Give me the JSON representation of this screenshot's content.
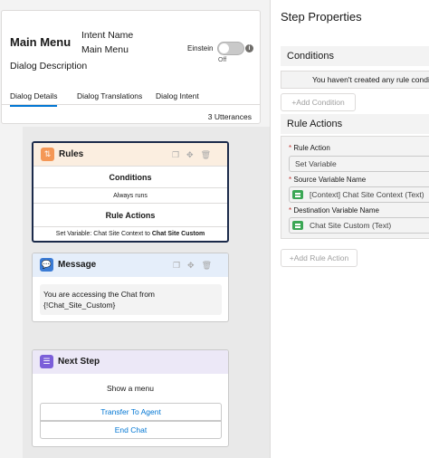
{
  "header": {
    "title": "Main Menu",
    "intent_label": "Intent Name",
    "intent_value": "Main Menu",
    "description": "Dialog Description",
    "toggle_label": "Einstein",
    "toggle_state": "Off",
    "tabs": [
      {
        "label": "Dialog Details",
        "active": true
      },
      {
        "label": "Dialog Translations",
        "active": false
      },
      {
        "label": "Dialog Intent",
        "active": false
      }
    ],
    "utterances": "3 Utterances"
  },
  "rules_card": {
    "title": "Rules",
    "conditions": "Conditions",
    "always": "Always runs",
    "rule_actions": "Rule Actions",
    "set_variable_prefix": "Set Variable: Chat Site Context to ",
    "set_variable_target": "Chat Site Custom",
    "icon": "rules-icon"
  },
  "message_card": {
    "title": "Message",
    "line1": "You are accessing the Chat from",
    "line2": "{!Chat_Site_Custom}",
    "icon": "chat-bubble-icon"
  },
  "next_step_card": {
    "title": "Next Step",
    "show_menu": "Show a menu",
    "items": [
      "Transfer To Agent",
      "End Chat"
    ],
    "icon": "next-step-icon"
  },
  "step_properties": {
    "title": "Step Properties",
    "conditions_heading": "Conditions",
    "no_rule_text": "You haven't created any rule conditions",
    "add_condition": "+Add Condition",
    "rule_actions_heading": "Rule Actions",
    "rule_action_label": "Rule Action",
    "rule_action_value": "Set Variable",
    "source_label": "Source Variable Name",
    "source_value": "[Context] Chat Site Context (Text)",
    "dest_label": "Destination Variable Name",
    "dest_value": "Chat Site Custom (Text)",
    "add_rule_action": "+Add Rule Action"
  },
  "colors": {
    "accent": "#0176d3",
    "rules_header": "#fbeee0",
    "message_header": "#e5eefa",
    "next_header": "#ece8f7",
    "variable_icon": "#3ba755"
  }
}
